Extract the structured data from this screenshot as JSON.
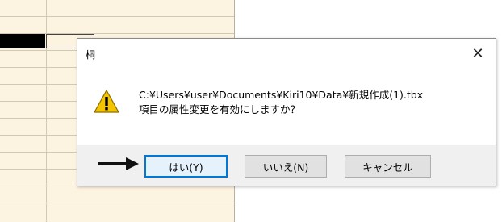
{
  "dialog": {
    "title": "桐",
    "close_symbol": "✕",
    "message_line1": "C:¥Users¥user¥Documents¥Kiri10¥Data¥新規作成(1).tbx",
    "message_line2": "項目の属性変更を有効にしますか？",
    "icon": "warning-icon",
    "buttons": {
      "yes": "はい(Y)",
      "no": "いいえ(N)",
      "cancel": "キャンセル"
    },
    "default_button": "yes"
  },
  "annotation": {
    "arrow_target": "yes",
    "arrow_icon": "right-arrow-icon"
  },
  "colors": {
    "focus_border": "#0078d7",
    "warning_fill": "#f5c400",
    "grid_background": "#fdf3e1"
  }
}
